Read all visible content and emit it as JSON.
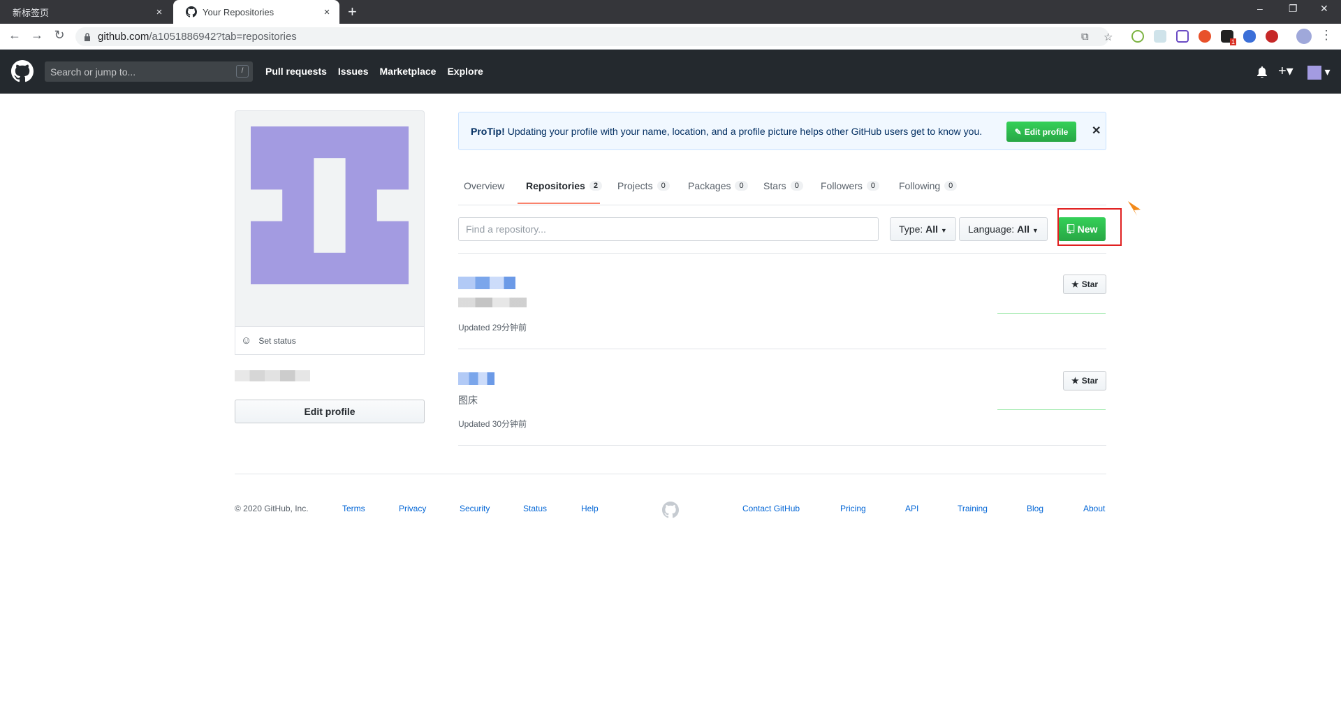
{
  "browser": {
    "tabs": [
      {
        "title": "新标签页",
        "close": "×"
      },
      {
        "title": "Your Repositories",
        "close": "×"
      }
    ],
    "new_tab": "+",
    "window_buttons": [
      "–",
      "❐",
      "✕"
    ],
    "url_host": "github.com",
    "url_path": "/a1051886942?tab=repositories",
    "ext_badge": "1"
  },
  "header": {
    "search_placeholder": "Search or jump to...",
    "search_hint": "/",
    "nav": [
      "Pull requests",
      "Issues",
      "Marketplace",
      "Explore"
    ]
  },
  "sidebar": {
    "set_status": "Set status",
    "edit_profile": "Edit profile",
    "avatar_color": "#a39be1"
  },
  "protip": {
    "label": "ProTip!",
    "text": "Updating your profile with your name, location, and a profile picture helps other GitHub users get to know you.",
    "button": "Edit profile",
    "close": "✕"
  },
  "tabs": [
    {
      "label": "Overview",
      "count": ""
    },
    {
      "label": "Repositories",
      "count": "2"
    },
    {
      "label": "Projects",
      "count": "0"
    },
    {
      "label": "Packages",
      "count": "0"
    },
    {
      "label": "Stars",
      "count": "0"
    },
    {
      "label": "Followers",
      "count": "0"
    },
    {
      "label": "Following",
      "count": "0"
    }
  ],
  "filters": {
    "search_placeholder": "Find a repository...",
    "type_label": "Type:",
    "type_value": "All",
    "language_label": "Language:",
    "language_value": "All",
    "new_button": "New"
  },
  "repos": [
    {
      "description": "",
      "updated": "Updated 29分钟前",
      "star": "Star"
    },
    {
      "description": "图床",
      "updated": "Updated 30分钟前",
      "star": "Star"
    }
  ],
  "footer": {
    "copyright": "© 2020 GitHub, Inc.",
    "left_links": [
      "Terms",
      "Privacy",
      "Security",
      "Status",
      "Help"
    ],
    "right_links": [
      "Contact GitHub",
      "Pricing",
      "API",
      "Training",
      "Blog",
      "About"
    ]
  }
}
